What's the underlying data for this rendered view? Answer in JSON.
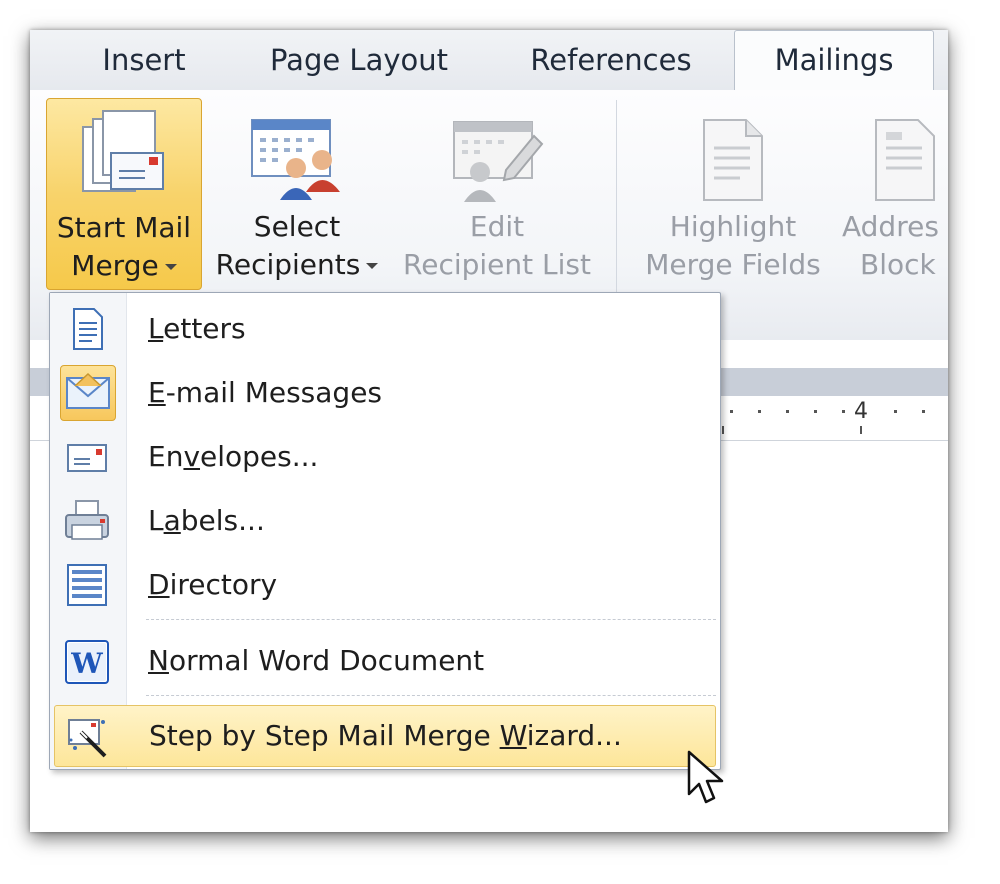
{
  "tabs": {
    "insert": "Insert",
    "page_layout": "Page Layout",
    "references": "References",
    "mailings": "Mailings"
  },
  "ribbon": {
    "start_mail_merge": {
      "line1": "Start Mail",
      "line2": "Merge"
    },
    "select_recipients": {
      "line1": "Select",
      "line2": "Recipients"
    },
    "edit_recipient_list": {
      "line1": "Edit",
      "line2": "Recipient List"
    },
    "highlight_merge_fields": {
      "line1": "Highlight",
      "line2": "Merge Fields"
    },
    "address_block": {
      "line1": "Addres",
      "line2": "Block"
    }
  },
  "ruler": {
    "marker": "4"
  },
  "menu": {
    "items": [
      {
        "pre": "",
        "key": "L",
        "post": "etters"
      },
      {
        "pre": "",
        "key": "E",
        "post": "-mail Messages"
      },
      {
        "pre": "En",
        "key": "v",
        "post": "elopes..."
      },
      {
        "pre": "L",
        "key": "a",
        "post": "bels..."
      },
      {
        "pre": "",
        "key": "D",
        "post": "irectory"
      },
      {
        "pre": "",
        "key": "N",
        "post": "ormal Word Document"
      },
      {
        "pre": "Step by Step Mail Merge ",
        "key": "W",
        "post": "izard..."
      }
    ]
  },
  "colors": {
    "selection_gold": "#f8d36b",
    "highlight_yellow": "#fde69a",
    "word_blue": "#1e56b8"
  }
}
